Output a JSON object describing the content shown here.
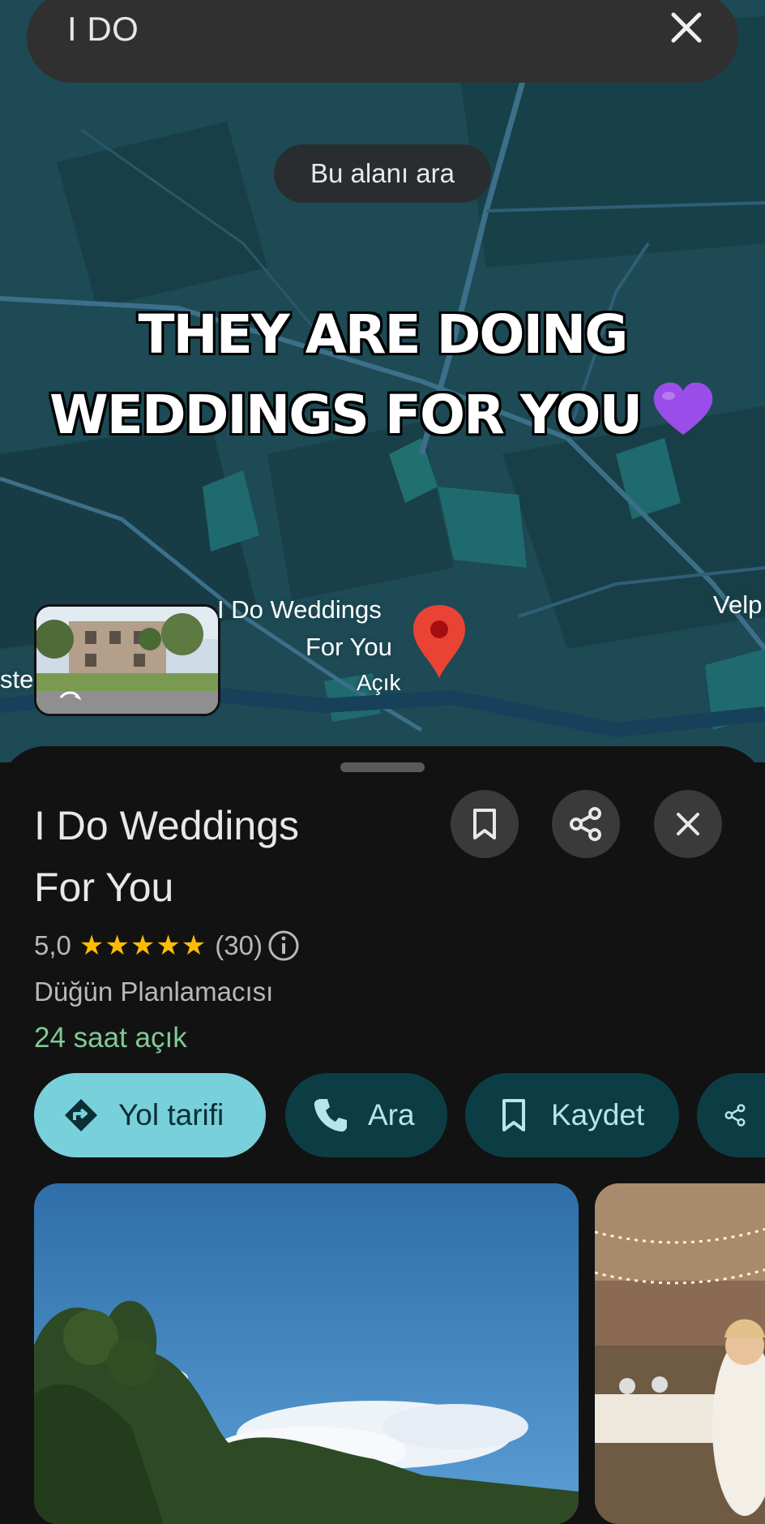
{
  "search": {
    "query": "I DO",
    "clear_label": "clear-search"
  },
  "map": {
    "search_area_label": "Bu alanı ara",
    "place_label_line1": "I Do Weddings",
    "place_label_line2": "For You",
    "place_status": "Açık",
    "edge_label_left": "ste",
    "edge_label_right": "Velp"
  },
  "overlay": {
    "line1": "THEY ARE DOING",
    "line2": "WEDDINGS FOR YOU"
  },
  "place": {
    "name_line1": "I Do Weddings",
    "name_line2": "For You",
    "rating": "5,0",
    "stars": "★★★★★",
    "review_count": "(30)",
    "category": "Düğün Planlamacısı",
    "hours": "24 saat açık"
  },
  "actions": {
    "directions": "Yol tarifi",
    "call": "Ara",
    "save": "Kaydet"
  },
  "colors": {
    "accent": "#78d0db",
    "open_green": "#81c995",
    "star": "#fbbc04",
    "pin": "#ea4335"
  }
}
